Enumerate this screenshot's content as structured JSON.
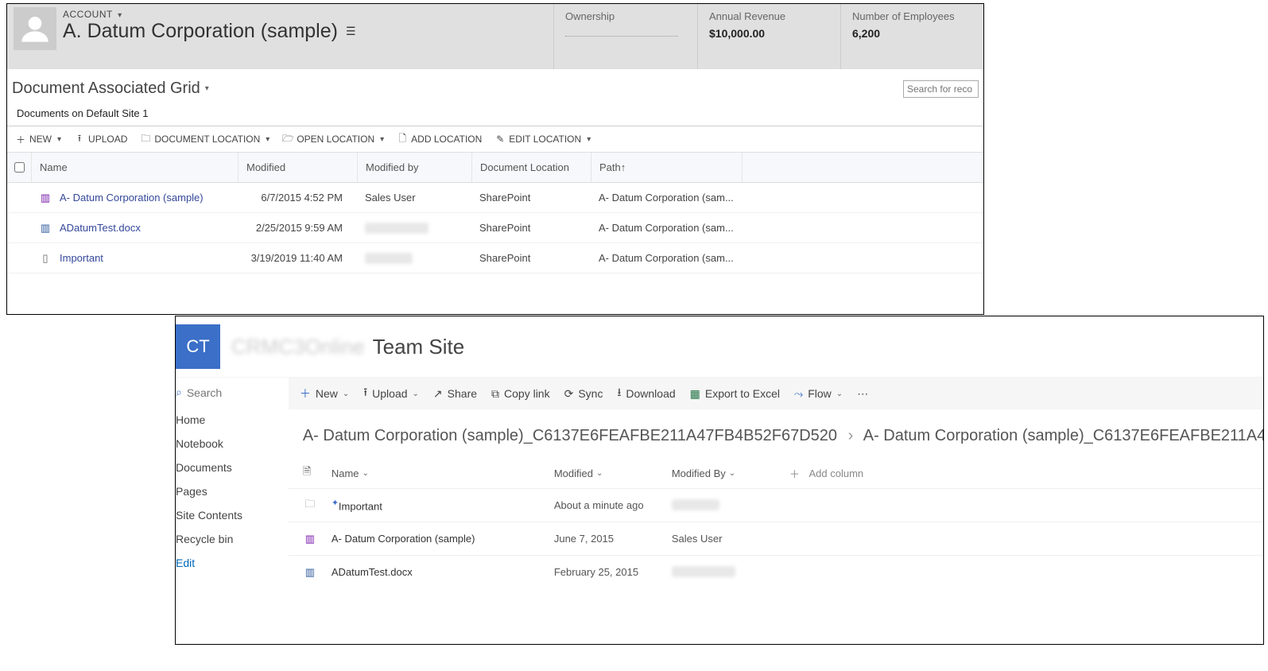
{
  "crm": {
    "account_label": "ACCOUNT",
    "account_name": "A. Datum Corporation (sample)",
    "meta": [
      {
        "label": "Ownership",
        "value": ""
      },
      {
        "label": "Annual Revenue",
        "value": "$10,000.00"
      },
      {
        "label": "Number of Employees",
        "value": "6,200"
      }
    ],
    "view_name": "Document Associated Grid",
    "subtitle": "Documents on Default Site 1",
    "search_placeholder": "Search for reco",
    "toolbar": {
      "new": "NEW",
      "upload": "UPLOAD",
      "doc_location": "DOCUMENT LOCATION",
      "open_location": "OPEN LOCATION",
      "add_location": "ADD LOCATION",
      "edit_location": "EDIT LOCATION"
    },
    "columns": {
      "name": "Name",
      "modified": "Modified",
      "modified_by": "Modified by",
      "doc_location": "Document Location",
      "path": "Path"
    },
    "rows": [
      {
        "name": "A- Datum Corporation (sample)",
        "modified": "6/7/2015 4:52 PM",
        "modified_by": "Sales User",
        "location": "SharePoint",
        "path": "A- Datum Corporation (sam...",
        "icon": "onenote"
      },
      {
        "name": "ADatumTest.docx",
        "modified": "2/25/2015 9:59 AM",
        "modified_by": "",
        "location": "SharePoint",
        "path": "A- Datum Corporation (sam...",
        "icon": "word"
      },
      {
        "name": "Important",
        "modified": "3/19/2019 11:40 AM",
        "modified_by": "",
        "location": "SharePoint",
        "path": "A- Datum Corporation (sam...",
        "icon": "generic"
      }
    ]
  },
  "sp": {
    "tile": "CT",
    "site_name": "Team Site",
    "search_label": "Search",
    "nav": [
      "Home",
      "Notebook",
      "Documents",
      "Pages",
      "Site Contents",
      "Recycle bin",
      "Edit"
    ],
    "commands": {
      "new": "New",
      "upload": "Upload",
      "share": "Share",
      "copylink": "Copy link",
      "sync": "Sync",
      "download": "Download",
      "export": "Export to Excel",
      "flow": "Flow"
    },
    "breadcrumb": {
      "a": "A- Datum Corporation (sample)_C6137E6FEAFBE211A47FB4B52F67D520",
      "b": "A- Datum Corporation (sample)_C6137E6FEAFBE211A4"
    },
    "columns": {
      "name": "Name",
      "modified": "Modified",
      "modified_by": "Modified By",
      "add": "Add column"
    },
    "rows": [
      {
        "name": "Important",
        "modified": "About a minute ago",
        "modified_by": "",
        "icon": "folder"
      },
      {
        "name": "A- Datum Corporation (sample)",
        "modified": "June 7, 2015",
        "modified_by": "Sales User",
        "icon": "onenote"
      },
      {
        "name": "ADatumTest.docx",
        "modified": "February 25, 2015",
        "modified_by": "",
        "icon": "word"
      }
    ]
  }
}
